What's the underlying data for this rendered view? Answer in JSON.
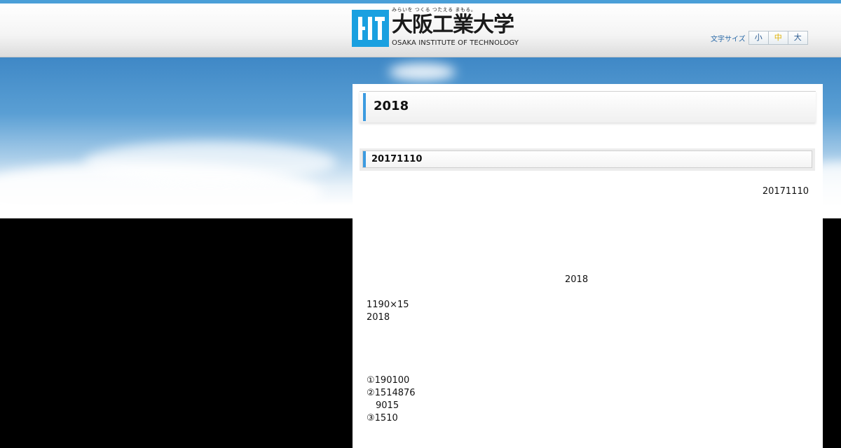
{
  "header": {
    "logo": {
      "tagline": "みらいを つくる つたえる まもる。",
      "name_jp": "大阪工業大学",
      "name_en": "OSAKA INSTITUTE OF TECHNOLOGY"
    },
    "font_size": {
      "label": "文字サイズ",
      "small": "小",
      "medium": "中",
      "large": "大",
      "selected": "中"
    }
  },
  "main": {
    "page_title": "2018",
    "section_title": "20171110",
    "date": "20171110",
    "center_line": "2018",
    "lines": [
      "1190×15",
      "2018"
    ],
    "list": [
      "①190100",
      "②1514876",
      "9015",
      "③1510"
    ]
  },
  "colors": {
    "accent": "#3c9be0",
    "top_bar": "#4a9fd8",
    "logo_blue": "#1aa0e0",
    "selected_size": "#e0b000"
  }
}
